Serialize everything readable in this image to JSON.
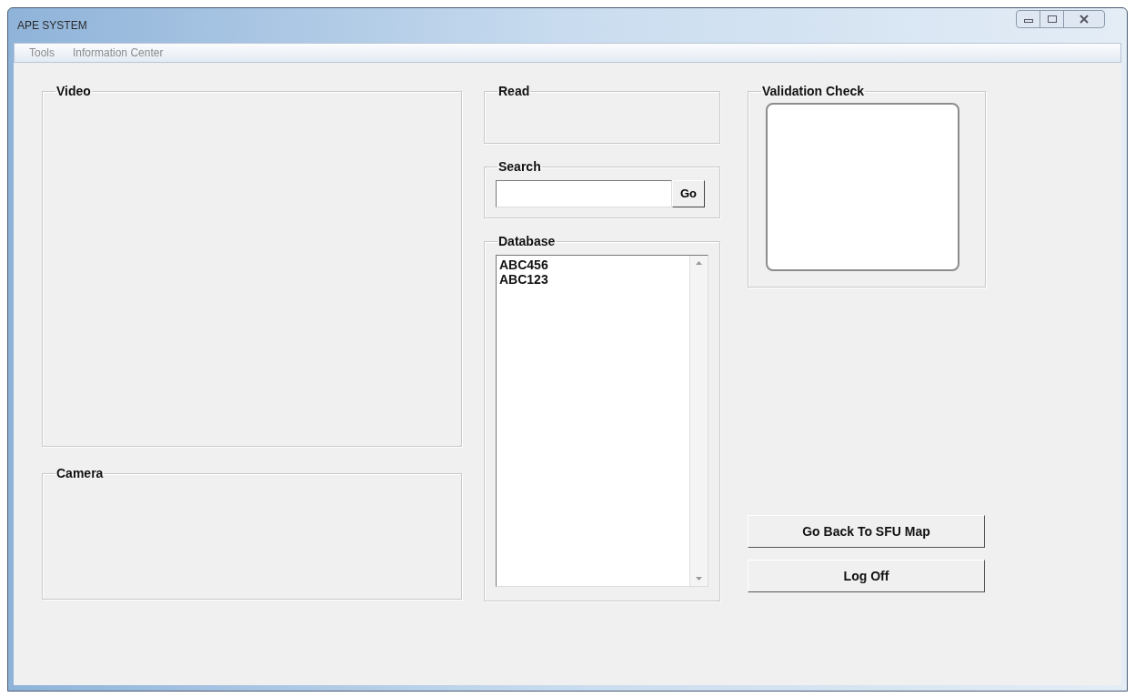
{
  "window": {
    "title": "APE SYSTEM"
  },
  "menu": [
    "Tools",
    "Information Center"
  ],
  "video": {
    "title": "Video"
  },
  "camera": {
    "title": "Camera"
  },
  "read": {
    "title": "Read"
  },
  "search": {
    "title": "Search",
    "button": "Go"
  },
  "database": {
    "title": "Database",
    "items": [
      "ABC456",
      "ABC123"
    ]
  },
  "validation": {
    "title": "Validation Check"
  },
  "buttons": [
    "Go Back To SFU Map",
    "Log Off"
  ]
}
